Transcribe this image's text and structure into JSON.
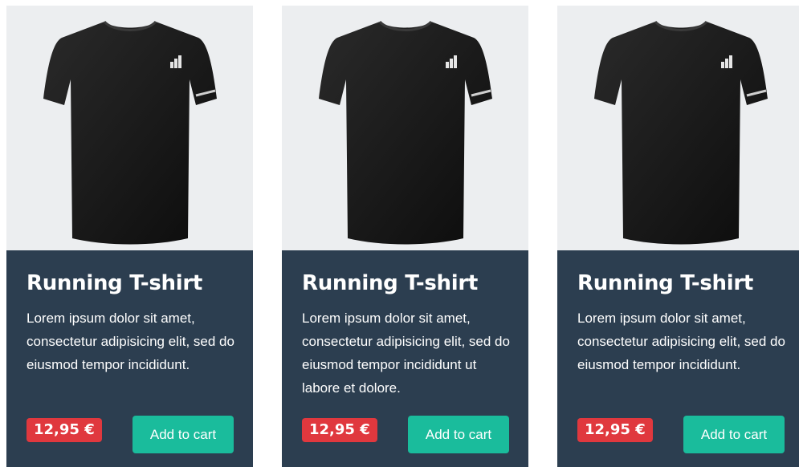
{
  "colors": {
    "image_bg": "#eceef0",
    "card_body_bg": "#2c3e50",
    "price_badge_bg": "#e0383e",
    "button_bg": "#1abc9c",
    "text": "#ffffff"
  },
  "products": [
    {
      "title": "Running T-shirt",
      "description": "Lorem ipsum dolor sit amet, consectetur adipisicing elit, sed do eiusmod tempor incididunt.",
      "price": "12,95 €",
      "button_label": "Add to cart",
      "image_icon": "black-tshirt-icon"
    },
    {
      "title": "Running T-shirt",
      "description": "Lorem ipsum dolor sit amet, consectetur adipisicing elit, sed do eiusmod tempor incididunt ut labore et dolore.",
      "price": "12,95 €",
      "button_label": "Add to cart",
      "image_icon": "black-tshirt-icon"
    },
    {
      "title": "Running T-shirt",
      "description": "Lorem ipsum dolor sit amet, consectetur adipisicing elit, sed do eiusmod tempor incididunt.",
      "price": "12,95 €",
      "button_label": "Add to cart",
      "image_icon": "black-tshirt-icon"
    }
  ]
}
